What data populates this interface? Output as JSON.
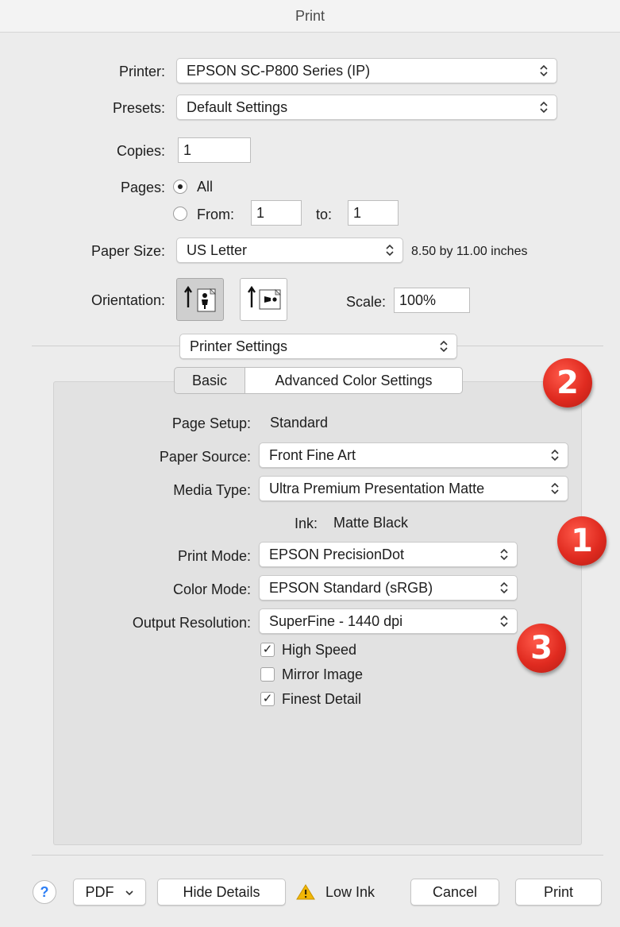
{
  "window": {
    "title": "Print"
  },
  "printer": {
    "label": "Printer:",
    "value": "EPSON SC-P800 Series (IP)"
  },
  "presets": {
    "label": "Presets:",
    "value": "Default Settings"
  },
  "copies": {
    "label": "Copies:",
    "value": "1"
  },
  "pages": {
    "label": "Pages:",
    "all_label": "All",
    "from_label": "From:",
    "from_value": "1",
    "to_label": "to:",
    "to_value": "1",
    "selected": "All"
  },
  "paper_size": {
    "label": "Paper Size:",
    "value": "US Letter",
    "dimensions": "8.50 by 11.00 inches"
  },
  "orientation": {
    "label": "Orientation:",
    "selected": "portrait"
  },
  "scale": {
    "label": "Scale:",
    "value": "100%"
  },
  "section_popup": {
    "value": "Printer Settings"
  },
  "tabs": [
    {
      "label": "Basic",
      "selected": false
    },
    {
      "label": "Advanced Color Settings",
      "selected": true
    }
  ],
  "settings": {
    "page_setup": {
      "label": "Page Setup:",
      "value": "Standard"
    },
    "paper_source": {
      "label": "Paper Source:",
      "value": "Front Fine Art"
    },
    "media_type": {
      "label": "Media Type:",
      "value": "Ultra Premium Presentation Matte"
    },
    "ink": {
      "label": "Ink:",
      "value": "Matte Black"
    },
    "print_mode": {
      "label": "Print Mode:",
      "value": "EPSON PrecisionDot"
    },
    "color_mode": {
      "label": "Color Mode:",
      "value": "EPSON Standard (sRGB)"
    },
    "output_resolution": {
      "label": "Output Resolution:",
      "value": "SuperFine - 1440 dpi"
    },
    "high_speed": {
      "label": "High Speed",
      "checked": true,
      "mark": "✓"
    },
    "mirror_image": {
      "label": "Mirror Image",
      "checked": false,
      "mark": ""
    },
    "finest_detail": {
      "label": "Finest Detail",
      "checked": true,
      "mark": "✓"
    }
  },
  "badges": {
    "one": "1",
    "two": "2",
    "three": "3"
  },
  "footer": {
    "help": "?",
    "pdf": "PDF",
    "hide_details": "Hide Details",
    "low_ink": "Low Ink",
    "cancel": "Cancel",
    "print": "Print"
  },
  "colors": {
    "badge_red": "#e02b20",
    "accent_blue": "#2d7ff5",
    "warning_yellow": "#f2b705"
  },
  "icons": {
    "popup": "up-down-chevron-icon",
    "warning": "warning-triangle-icon",
    "orientation_portrait": "portrait-person-icon",
    "orientation_landscape": "landscape-person-icon"
  }
}
